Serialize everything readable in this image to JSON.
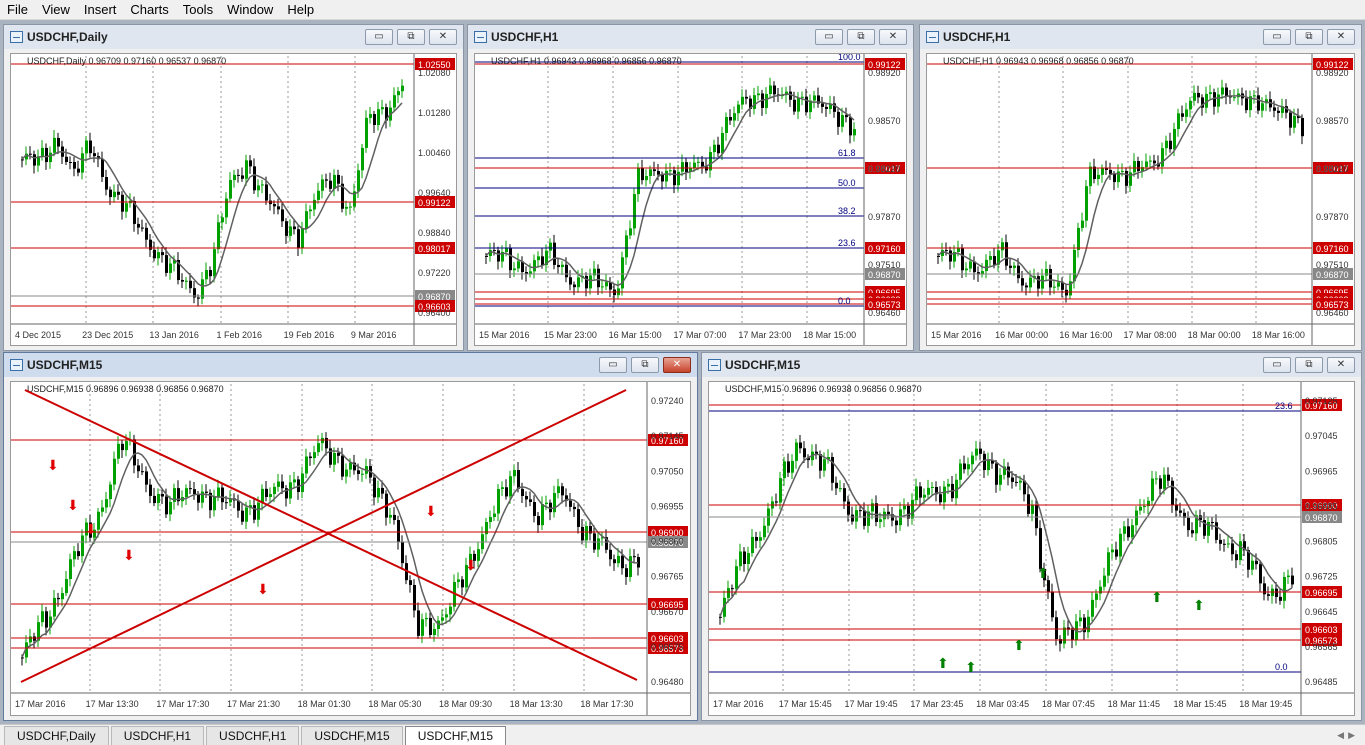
{
  "menu": [
    "File",
    "View",
    "Insert",
    "Charts",
    "Tools",
    "Window",
    "Help"
  ],
  "colors": {
    "level_red": "#cc0000",
    "fib_blue": "#000080",
    "ma_grey": "#606060",
    "bull": "#00a000",
    "bear": "#000000",
    "zone_green": "#90ee90",
    "zone_orange": "#ffd9a0",
    "zone_grey": "#d6d6d6",
    "gold": "#d4a000",
    "arrow_red": "#e00000",
    "arrow_green": "#008000",
    "cyan": "#3fd0d0"
  },
  "window_buttons": {
    "minimize": "▭",
    "restore": "⧉",
    "close": "✕"
  },
  "windows": [
    {
      "title": "USDCHF,Daily",
      "info": "USDCHF,Daily  0.96709 0.97160 0.96537 0.96870",
      "price_labels": [
        "1.02080",
        "1.01280",
        "1.00460",
        "0.99640",
        "0.98840",
        "0.97220",
        "0.96400"
      ],
      "levels": [
        {
          "value": "1.02550",
          "boxed": true
        },
        {
          "value": "0.99122",
          "boxed": true
        },
        {
          "value": "0.98017",
          "boxed": true
        },
        {
          "value": "0.96870",
          "boxed": true,
          "grey": true
        },
        {
          "value": "0.96603",
          "boxed": true
        }
      ],
      "time_labels": [
        "4 Dec 2015",
        "23 Dec 2015",
        "13 Jan 2016",
        "1 Feb 2016",
        "19 Feb 2016",
        "9 Mar 2016"
      ]
    },
    {
      "title": "USDCHF,H1",
      "info": "USDCHF,H1  0.96943 0.96968 0.96856 0.96870",
      "price_labels": [
        "0.98920",
        "0.98570",
        "0.98220",
        "0.97870",
        "0.97510",
        "0.96460"
      ],
      "levels": [
        {
          "value": "0.99122",
          "boxed": true
        },
        {
          "value": "0.98017",
          "boxed": true
        },
        {
          "value": "0.97160",
          "boxed": true
        },
        {
          "value": "0.96870",
          "boxed": true,
          "grey": true
        },
        {
          "value": "0.96695",
          "boxed": true
        },
        {
          "value": "0.96603",
          "boxed": true
        },
        {
          "value": "0.96573",
          "boxed": true
        }
      ],
      "fib_labels": [
        "100.0",
        "61.8",
        "50.0",
        "38.2",
        "23.6",
        "0.0"
      ],
      "time_labels": [
        "15 Mar 2016",
        "15 Mar 23:00",
        "16 Mar 15:00",
        "17 Mar 07:00",
        "17 Mar 23:00",
        "18 Mar 15:00"
      ]
    },
    {
      "title": "USDCHF,H1",
      "info": "USDCHF,H1  0.96943 0.96968 0.96856 0.96870",
      "price_labels": [
        "0.98920",
        "0.98570",
        "0.98220",
        "0.97870",
        "0.97510",
        "0.96460"
      ],
      "levels": [
        {
          "value": "0.99122",
          "boxed": true
        },
        {
          "value": "0.98017",
          "boxed": true
        },
        {
          "value": "0.97160",
          "boxed": true
        },
        {
          "value": "0.96870",
          "boxed": true,
          "grey": true
        },
        {
          "value": "0.96695",
          "boxed": true
        },
        {
          "value": "0.96603",
          "boxed": true
        },
        {
          "value": "0.96573",
          "boxed": true
        }
      ],
      "time_labels": [
        "15 Mar 2016",
        "16 Mar 00:00",
        "16 Mar 16:00",
        "17 Mar 08:00",
        "18 Mar 00:00",
        "18 Mar 16:00"
      ]
    },
    {
      "title": "USDCHF,M15",
      "info": "USDCHF,M15  0.96896 0.96938 0.96856 0.96870",
      "price_labels": [
        "0.97240",
        "0.97145",
        "0.97050",
        "0.96955",
        "0.96860",
        "0.96765",
        "0.96670",
        "0.96575",
        "0.96480"
      ],
      "levels": [
        {
          "value": "0.97160",
          "boxed": true
        },
        {
          "value": "0.96900",
          "boxed": true
        },
        {
          "value": "0.96870",
          "boxed": true,
          "grey": true
        },
        {
          "value": "0.96695",
          "boxed": true
        },
        {
          "value": "0.96603",
          "boxed": true
        },
        {
          "value": "0.96573",
          "boxed": true
        }
      ],
      "time_labels": [
        "17 Mar 2016",
        "17 Mar 13:30",
        "17 Mar 17:30",
        "17 Mar 21:30",
        "18 Mar 01:30",
        "18 Mar 05:30",
        "18 Mar 09:30",
        "18 Mar 13:30",
        "18 Mar 17:30"
      ]
    },
    {
      "title": "USDCHF,M15",
      "info": "USDCHF,M15  0.96896 0.96938 0.96856 0.96870",
      "price_labels": [
        "0.97125",
        "0.97045",
        "0.96965",
        "0.96885",
        "0.96805",
        "0.96725",
        "0.96645",
        "0.96565",
        "0.96485"
      ],
      "levels": [
        {
          "value": "0.97160",
          "boxed": true
        },
        {
          "value": "0.96900",
          "boxed": true
        },
        {
          "value": "0.96870",
          "boxed": true,
          "grey": true
        },
        {
          "value": "0.96695",
          "boxed": true
        },
        {
          "value": "0.96603",
          "boxed": true
        },
        {
          "value": "0.96573",
          "boxed": true
        }
      ],
      "fib_labels": [
        "23.6",
        "0.0"
      ],
      "time_labels": [
        "17 Mar 2016",
        "17 Mar 15:45",
        "17 Mar 19:45",
        "17 Mar 23:45",
        "18 Mar 03:45",
        "18 Mar 07:45",
        "18 Mar 11:45",
        "18 Mar 15:45",
        "18 Mar 19:45"
      ]
    }
  ],
  "tabs": [
    "USDCHF,Daily",
    "USDCHF,H1",
    "USDCHF,H1",
    "USDCHF,M15",
    "USDCHF,M15"
  ],
  "active_tab": 4
}
